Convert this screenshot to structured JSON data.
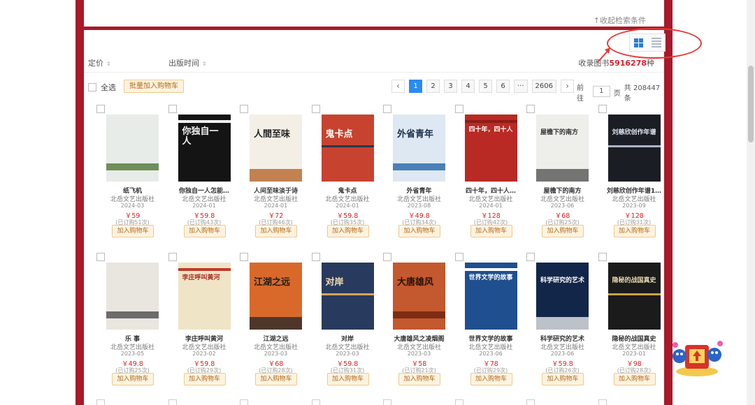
{
  "search_panel": {
    "collapse_label": "↑收起检索条件"
  },
  "view_switch": {
    "grid_icon": "grid-icon",
    "list_icon": "list-icon",
    "active": "grid"
  },
  "sort_bar": {
    "price_label": "定价",
    "date_label": "出版时间",
    "sort_arrows": "⇕",
    "count_prefix": "收录图书",
    "count_value": "5916278",
    "count_suffix": "种"
  },
  "toolbar": {
    "select_all_label": "全选",
    "batch_add_label": "批量加入购物车"
  },
  "pagination": {
    "prev": "‹",
    "pages": [
      "1",
      "2",
      "3",
      "4",
      "5",
      "6"
    ],
    "ellipsis": "···",
    "last": "2606",
    "next": "›",
    "goto_prefix": "前往",
    "goto_value": "1",
    "goto_suffix": "页",
    "total_label": "共 208447 条",
    "active_page": "1"
  },
  "add_to_cart_label": "加入购物车",
  "books": [
    {
      "title": "纸飞机",
      "publisher": "北岳文艺出版社",
      "date": "2024-03",
      "price": "￥59",
      "orders": "(已订购51次)",
      "cover_bg": "#e7ece9",
      "cover_accent": "#6e8f5a",
      "cover_text": "",
      "cover_text_color": "#333"
    },
    {
      "title": "你独自一人怎能…",
      "publisher": "北岳文艺出版社",
      "date": "2024-01",
      "price": "￥59.8",
      "orders": "(已订购43次)",
      "cover_bg": "#141414",
      "cover_accent": "#f2f2f2",
      "cover_text": "你独自一人",
      "cover_text_color": "#f2f2f2"
    },
    {
      "title": "人间至味淡于诗",
      "publisher": "北岳文艺出版社",
      "date": "2024-01",
      "price": "￥72",
      "orders": "(已订购46次)",
      "cover_bg": "#f4efe6",
      "cover_accent": "#b5652a",
      "cover_text": "人間至味",
      "cover_text_color": "#222"
    },
    {
      "title": "鬼卡点",
      "publisher": "北岳文艺出版社",
      "date": "2024-01",
      "price": "￥59.8",
      "orders": "(已订购35次)",
      "cover_bg": "#c7432f",
      "cover_accent": "#26384f",
      "cover_text": "鬼卡点",
      "cover_text_color": "#ffffff"
    },
    {
      "title": "外省青年",
      "publisher": "北岳文艺出版社",
      "date": "2023-08",
      "price": "￥49.8",
      "orders": "(已订购34次)",
      "cover_bg": "#dde8f2",
      "cover_accent": "#4a7fb8",
      "cover_text": "外省青年",
      "cover_text_color": "#1c2f4a"
    },
    {
      "title": "四十年，四十人…",
      "publisher": "北岳文艺出版社",
      "date": "2024-01",
      "price": "￥128",
      "orders": "(已订购42次)",
      "cover_bg": "#b92a24",
      "cover_accent": "#8e1c18",
      "cover_text": "四十年，四十人",
      "cover_text_color": "#ffffff"
    },
    {
      "title": "屋檐下的南方",
      "publisher": "北岳文艺出版社",
      "date": "2023-06",
      "price": "￥68",
      "orders": "(已订购25次)",
      "cover_bg": "#eeeeea",
      "cover_accent": "#555555",
      "cover_text": "屋檐下的南方",
      "cover_text_color": "#333"
    },
    {
      "title": "刘慈欣创作年谱1…",
      "publisher": "北岳文艺出版社",
      "date": "2023-09",
      "price": "￥128",
      "orders": "(已订购31次)",
      "cover_bg": "#1a1d24",
      "cover_accent": "#aab4c8",
      "cover_text": "刘慈欣创作年谱",
      "cover_text_color": "#dfe6f0"
    },
    {
      "title": "乐 事",
      "publisher": "北岳文艺出版社",
      "date": "2023-05",
      "price": "￥49.8",
      "orders": "(已订购25次)",
      "cover_bg": "#e9e6df",
      "cover_accent": "#6b6b6b",
      "cover_text": "",
      "cover_text_color": "#333"
    },
    {
      "title": "李庄呼叫黄河",
      "publisher": "北岳文艺出版社",
      "date": "2023-02",
      "price": "￥59.8",
      "orders": "(已订购29次)",
      "cover_bg": "#efe4c6",
      "cover_accent": "#c0392b",
      "cover_text": "李庄呼叫黄河",
      "cover_text_color": "#b02a1e"
    },
    {
      "title": "江湖之远",
      "publisher": "北岳文艺出版社",
      "date": "2023-03",
      "price": "￥68",
      "orders": "(已订购28次)",
      "cover_bg": "#d9692a",
      "cover_accent": "#2a2a2a",
      "cover_text": "江湖之远",
      "cover_text_color": "#1d1d1d"
    },
    {
      "title": "对岸",
      "publisher": "北岳文艺出版社",
      "date": "2023-03",
      "price": "￥59.8",
      "orders": "(已订购31次)",
      "cover_bg": "#283a5e",
      "cover_accent": "#d9a35a",
      "cover_text": "对岸",
      "cover_text_color": "#f3dcb0"
    },
    {
      "title": "大唐雄风之凌烟阁",
      "publisher": "北岳文艺出版社",
      "date": "2023-03",
      "price": "￥58",
      "orders": "(已订购21次)",
      "cover_bg": "#c4582e",
      "cover_accent": "#7d2d14",
      "cover_text": "大唐雄风",
      "cover_text_color": "#2a1208"
    },
    {
      "title": "世界文学的故事",
      "publisher": "北岳文艺出版社",
      "date": "2023-06",
      "price": "￥78",
      "orders": "(已订购29次)",
      "cover_bg": "#1f4f8f",
      "cover_accent": "#ffffff",
      "cover_text": "世界文学的故事",
      "cover_text_color": "#ffffff"
    },
    {
      "title": "科学研究的艺术",
      "publisher": "北岳文艺出版社",
      "date": "2023-06",
      "price": "￥59.8",
      "orders": "(已订购26次)",
      "cover_bg": "#12264a",
      "cover_accent": "#e8e8e8",
      "cover_text": "科学研究的艺术",
      "cover_text_color": "#ffffff"
    },
    {
      "title": "隐秘的战国真史",
      "publisher": "北岳文艺出版社",
      "date": "2023-01",
      "price": "￥98",
      "orders": "(已订购28次)",
      "cover_bg": "#1b1b1b",
      "cover_accent": "#c9a24a",
      "cover_text": "隐秘的战国真史",
      "cover_text_color": "#e8d9b0"
    }
  ]
}
